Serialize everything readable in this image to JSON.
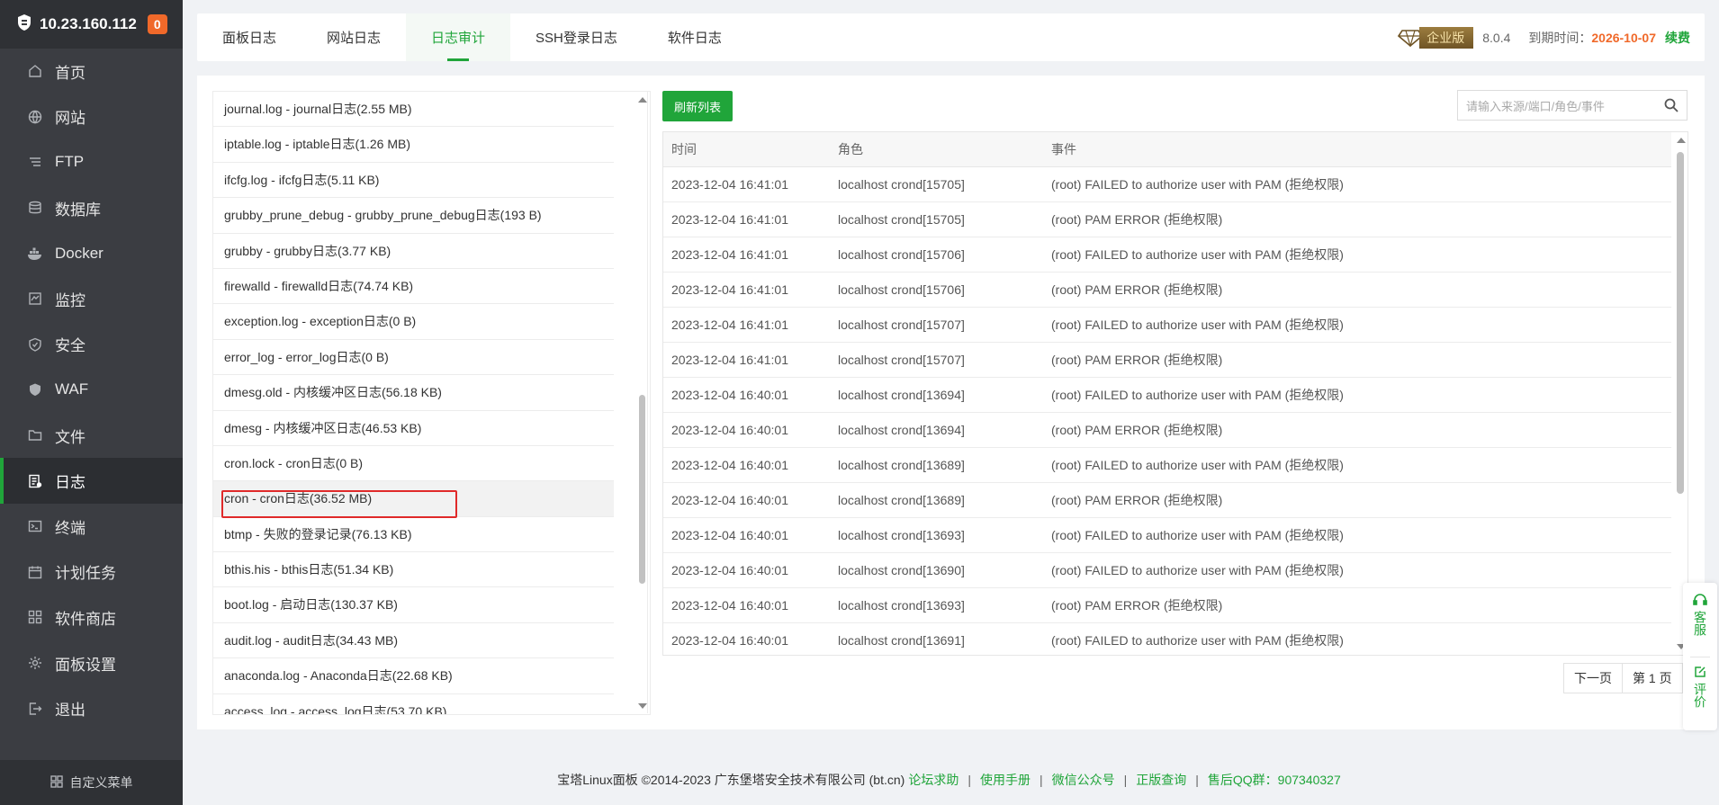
{
  "sidebar": {
    "ip": "10.23.160.112",
    "badge": "0",
    "items": [
      {
        "label": "首页",
        "icon": "home-icon"
      },
      {
        "label": "网站",
        "icon": "globe-icon"
      },
      {
        "label": "FTP",
        "icon": "ftp-icon"
      },
      {
        "label": "数据库",
        "icon": "database-icon"
      },
      {
        "label": "Docker",
        "icon": "docker-icon"
      },
      {
        "label": "监控",
        "icon": "monitor-icon"
      },
      {
        "label": "安全",
        "icon": "shield-icon"
      },
      {
        "label": "WAF",
        "icon": "waf-shield-icon"
      },
      {
        "label": "文件",
        "icon": "folder-icon"
      },
      {
        "label": "日志",
        "icon": "log-icon"
      },
      {
        "label": "终端",
        "icon": "terminal-icon"
      },
      {
        "label": "计划任务",
        "icon": "calendar-icon"
      },
      {
        "label": "软件商店",
        "icon": "grid-icon"
      },
      {
        "label": "面板设置",
        "icon": "gear-icon"
      },
      {
        "label": "退出",
        "icon": "logout-icon"
      }
    ],
    "active_index": 9,
    "footer_label": "自定义菜单"
  },
  "tabs": [
    "面板日志",
    "网站日志",
    "日志审计",
    "SSH登录日志",
    "软件日志"
  ],
  "active_tab": 2,
  "header_right": {
    "edition": "企业版",
    "version": "8.0.4",
    "expire_label": "到期时间：",
    "expire_date": "2026-10-07",
    "renew": "续费"
  },
  "log_files": [
    "journal.log - journal日志(2.55 MB)",
    "iptable.log - iptable日志(1.26 MB)",
    "ifcfg.log - ifcfg日志(5.11 KB)",
    "grubby_prune_debug - grubby_prune_debug日志(193 B)",
    "grubby - grubby日志(3.77 KB)",
    "firewalld - firewalld日志(74.74 KB)",
    "exception.log - exception日志(0 B)",
    "error_log - error_log日志(0 B)",
    "dmesg.old - 内核缓冲区日志(56.18 KB)",
    "dmesg - 内核缓冲区日志(46.53 KB)",
    "cron.lock - cron日志(0 B)",
    "cron - cron日志(36.52 MB)",
    "btmp - 失败的登录记录(76.13 KB)",
    "bthis.his - bthis日志(51.34 KB)",
    "boot.log - 启动日志(130.37 KB)",
    "audit.log - audit日志(34.43 MB)",
    "anaconda.log - Anaconda日志(22.68 KB)",
    "access_log - access_log日志(53.70 KB)"
  ],
  "selected_log_index": 11,
  "refresh_label": "刷新列表",
  "search_placeholder": "请输入来源/端口/角色/事件",
  "table": {
    "headers": [
      "时间",
      "角色",
      "事件"
    ],
    "rows": [
      [
        "2023-12-04 16:41:01",
        "localhost crond[15705]",
        "(root) FAILED to authorize user with PAM (拒绝权限)"
      ],
      [
        "2023-12-04 16:41:01",
        "localhost crond[15705]",
        "(root) PAM ERROR (拒绝权限)"
      ],
      [
        "2023-12-04 16:41:01",
        "localhost crond[15706]",
        "(root) FAILED to authorize user with PAM (拒绝权限)"
      ],
      [
        "2023-12-04 16:41:01",
        "localhost crond[15706]",
        "(root) PAM ERROR (拒绝权限)"
      ],
      [
        "2023-12-04 16:41:01",
        "localhost crond[15707]",
        "(root) FAILED to authorize user with PAM (拒绝权限)"
      ],
      [
        "2023-12-04 16:41:01",
        "localhost crond[15707]",
        "(root) PAM ERROR (拒绝权限)"
      ],
      [
        "2023-12-04 16:40:01",
        "localhost crond[13694]",
        "(root) FAILED to authorize user with PAM (拒绝权限)"
      ],
      [
        "2023-12-04 16:40:01",
        "localhost crond[13694]",
        "(root) PAM ERROR (拒绝权限)"
      ],
      [
        "2023-12-04 16:40:01",
        "localhost crond[13689]",
        "(root) FAILED to authorize user with PAM (拒绝权限)"
      ],
      [
        "2023-12-04 16:40:01",
        "localhost crond[13689]",
        "(root) PAM ERROR (拒绝权限)"
      ],
      [
        "2023-12-04 16:40:01",
        "localhost crond[13693]",
        "(root) FAILED to authorize user with PAM (拒绝权限)"
      ],
      [
        "2023-12-04 16:40:01",
        "localhost crond[13690]",
        "(root) FAILED to authorize user with PAM (拒绝权限)"
      ],
      [
        "2023-12-04 16:40:01",
        "localhost crond[13693]",
        "(root) PAM ERROR (拒绝权限)"
      ],
      [
        "2023-12-04 16:40:01",
        "localhost crond[13691]",
        "(root) FAILED to authorize user with PAM (拒绝权限)"
      ]
    ]
  },
  "pager": {
    "next": "下一页",
    "page": "第 1 页"
  },
  "footer": {
    "copyright": "宝塔Linux面板 ©2014-2023 广东堡塔安全技术有限公司 (bt.cn)",
    "links": [
      "论坛求助",
      "使用手册",
      "微信公众号",
      "正版查询",
      "售后QQ群：907340327"
    ]
  },
  "float": {
    "service": "客服",
    "review": "评价"
  },
  "colors": {
    "accent": "#20a53a",
    "sidebar": "#3b3d42",
    "highlight": "#e02a2a",
    "expire": "#f0692a"
  }
}
